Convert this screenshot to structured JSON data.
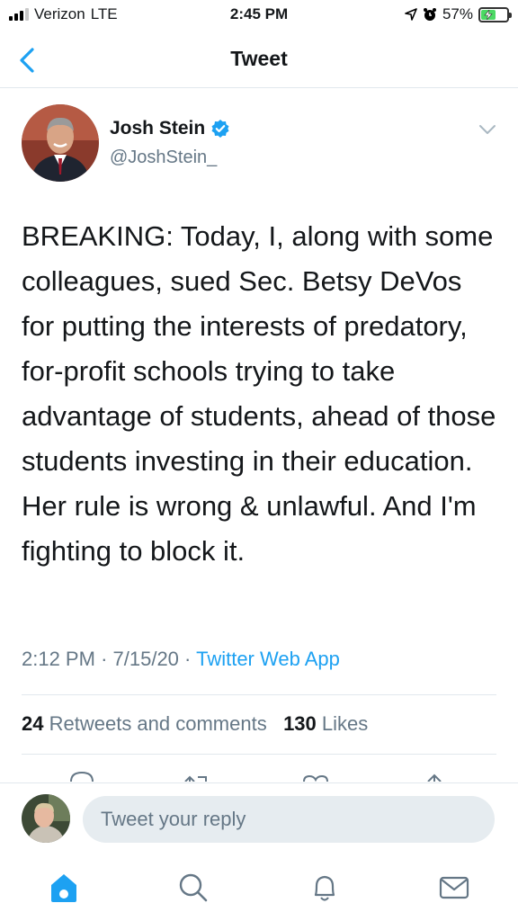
{
  "status_bar": {
    "carrier": "Verizon",
    "network": "LTE",
    "time": "2:45 PM",
    "battery": "57%",
    "battery_level": 0.57
  },
  "header": {
    "title": "Tweet"
  },
  "tweet": {
    "author_name": "Josh Stein",
    "author_handle": "@JoshStein_",
    "verified": true,
    "text": "BREAKING: Today, I, along with some colleagues, sued Sec. Betsy DeVos for putting the interests of predatory, for-profit schools trying to take advantage of students, ahead of those students investing in their education. Her rule is wrong & unlawful. And I'm fighting to block it.",
    "time": "2:12 PM",
    "date": "7/15/20",
    "source": "Twitter Web App",
    "retweets_count": "24",
    "retweets_label": "Retweets and comments",
    "likes_count": "130",
    "likes_label": "Likes"
  },
  "reply": {
    "placeholder": "Tweet your reply"
  },
  "colors": {
    "accent": "#1da1f2",
    "secondary_text": "#657786",
    "divider": "#e1e8ed"
  },
  "icons": {
    "back": "chevron-left-icon",
    "caret": "chevron-down-icon",
    "verified": "verified-badge-icon",
    "nav": [
      "home-icon",
      "search-icon",
      "bell-icon",
      "mail-icon"
    ],
    "actions": [
      "reply-icon",
      "retweet-icon",
      "like-icon",
      "share-icon"
    ]
  }
}
